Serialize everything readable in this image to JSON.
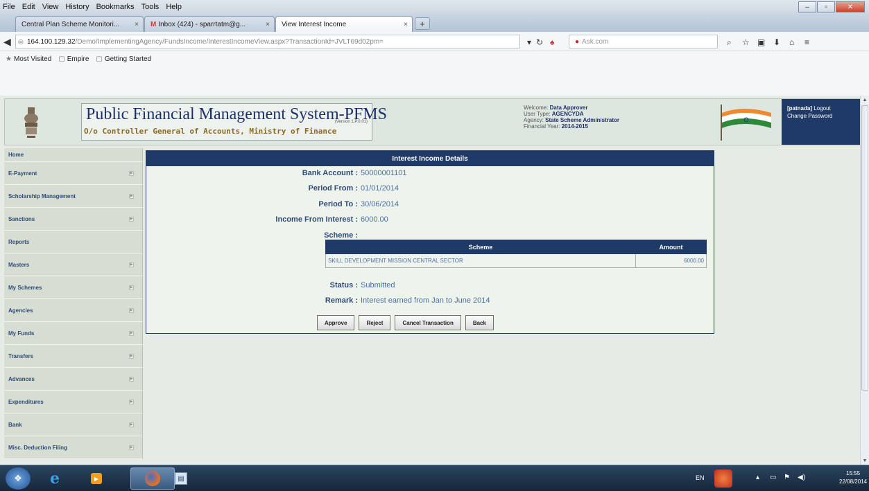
{
  "browser": {
    "menu": [
      "File",
      "Edit",
      "View",
      "History",
      "Bookmarks",
      "Tools",
      "Help"
    ],
    "tabs": [
      {
        "label": "Central Plan Scheme Monitori..."
      },
      {
        "label": "Inbox (424) - sparrtatm@g..."
      },
      {
        "label": "View Interest Income"
      }
    ],
    "url_host": "164.100.129.32",
    "url_path": "/Demo/ImplementingAgency/FundsIncome/InterestIncomeView.aspx?TransactionId=JVLT69d02pm=",
    "search_placeholder": "Ask.com",
    "bookmarks": [
      "Most Visited",
      "Empire",
      "Getting Started"
    ]
  },
  "header": {
    "title": "Public Financial Management System-PFMS",
    "subtitle": "O/o Controller General of Accounts, Ministry of Finance",
    "version": "(Version 1.P.0.01)",
    "welcome_label": "Welcome:",
    "welcome_value": "Data Approver",
    "user_type_label": "User Type:",
    "user_type_value": "AGENCYDA",
    "agency_label": "Agency:",
    "agency_value": "State Scheme Administrator",
    "fy_label": "Financial Year:",
    "fy_value": "2014-2015",
    "username": "[patnada]",
    "logout": "Logout",
    "change_password": "Change Password"
  },
  "sidebar": {
    "items": [
      {
        "label": "Home"
      },
      {
        "label": "E-Payment"
      },
      {
        "label": "Scholarship Management"
      },
      {
        "label": "Sanctions"
      },
      {
        "label": "Reports"
      },
      {
        "label": "Masters"
      },
      {
        "label": "My Schemes"
      },
      {
        "label": "Agencies"
      },
      {
        "label": "My Funds"
      },
      {
        "label": "Transfers"
      },
      {
        "label": "Advances"
      },
      {
        "label": "Expenditures"
      },
      {
        "label": "Bank"
      },
      {
        "label": "Misc. Deduction Filing"
      }
    ]
  },
  "panel": {
    "title": "Interest Income Details",
    "fields": {
      "bank_account_label": "Bank Account :",
      "bank_account_value": "50000001101",
      "period_from_label": "Period From :",
      "period_from_value": "01/01/2014",
      "period_to_label": "Period To :",
      "period_to_value": "30/06/2014",
      "income_label": "Income From Interest :",
      "income_value": "6000.00",
      "scheme_label": "Scheme :",
      "status_label": "Status :",
      "status_value": "Submitted",
      "remark_label": "Remark :",
      "remark_value": "Interest earned from Jan to June 2014"
    },
    "table": {
      "headers": [
        "Scheme",
        "Amount"
      ],
      "rows": [
        {
          "scheme": "SKILL DEVELOPMENT MISSION CENTRAL SECTOR",
          "amount": "6000.00"
        }
      ]
    },
    "buttons": {
      "approve": "Approve",
      "reject": "Reject",
      "cancel": "Cancel Transaction",
      "back": "Back"
    }
  },
  "taskbar": {
    "lang": "EN",
    "time": "15:55",
    "date": "22/08/2014"
  }
}
